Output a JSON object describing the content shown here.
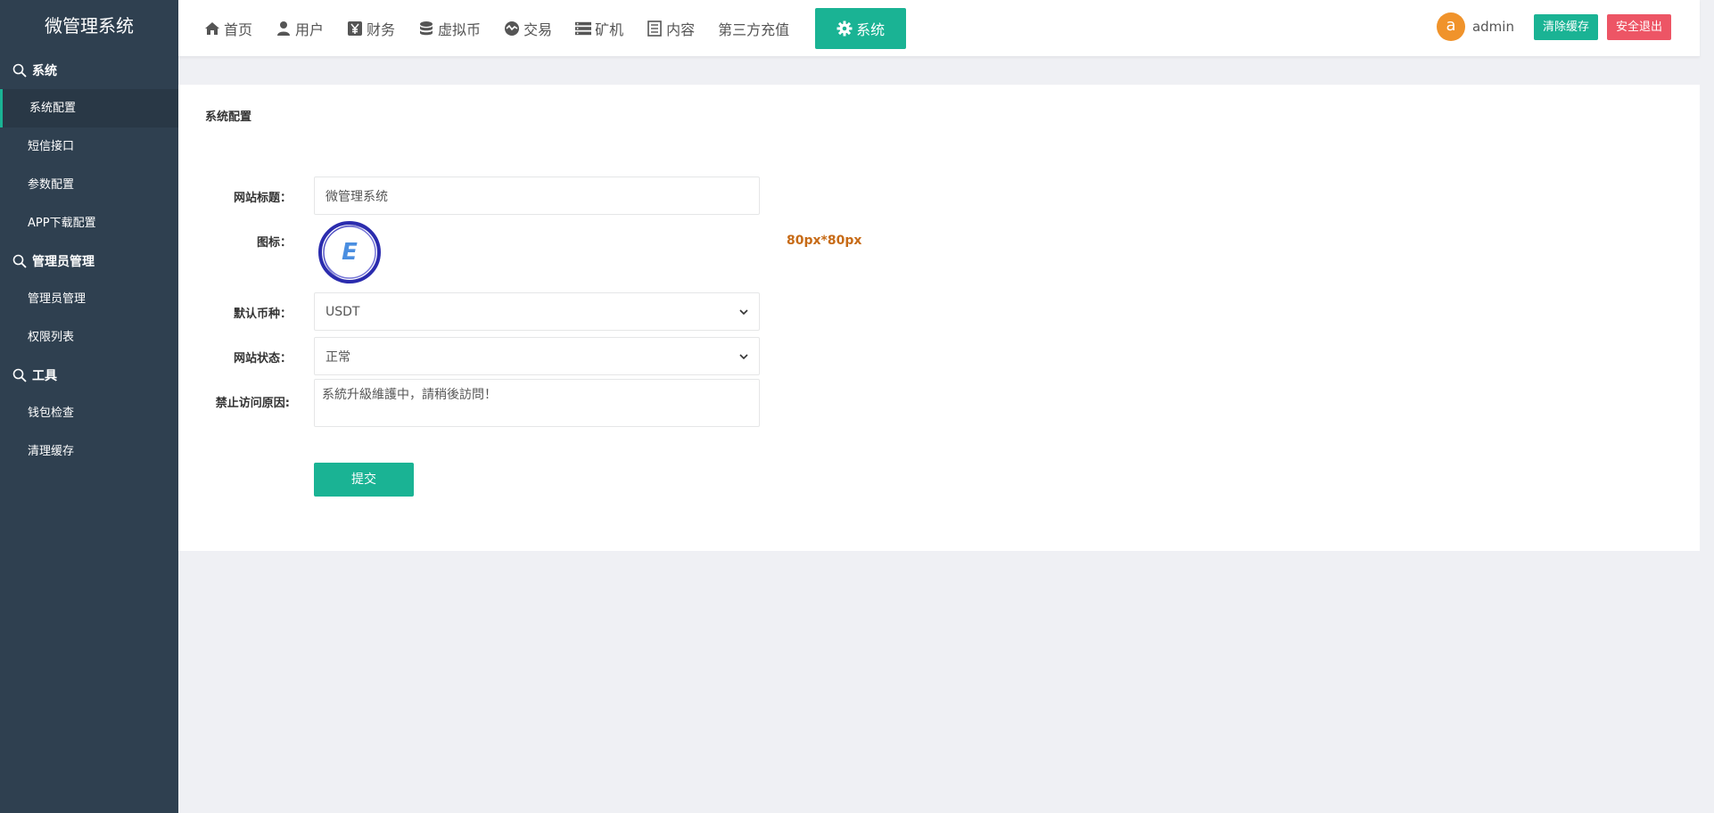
{
  "sidebar": {
    "brand": "微管理系统",
    "groups": [
      {
        "label": "系统",
        "items": [
          {
            "label": "系统配置"
          },
          {
            "label": "短信接口"
          },
          {
            "label": "参数配置"
          },
          {
            "label": "APP下载配置"
          }
        ]
      },
      {
        "label": "管理员管理",
        "items": [
          {
            "label": "管理员管理"
          },
          {
            "label": "权限列表"
          }
        ]
      },
      {
        "label": "工具",
        "items": [
          {
            "label": "钱包检查"
          },
          {
            "label": "清理缓存"
          }
        ]
      }
    ]
  },
  "nav": {
    "items": [
      {
        "label": "首页",
        "icon": "home-icon"
      },
      {
        "label": "用户",
        "icon": "user-icon"
      },
      {
        "label": "财务",
        "icon": "yen-icon"
      },
      {
        "label": "虚拟币",
        "icon": "database-icon"
      },
      {
        "label": "交易",
        "icon": "exchange-icon"
      },
      {
        "label": "矿机",
        "icon": "server-icon"
      },
      {
        "label": "内容",
        "icon": "list-icon"
      },
      {
        "label": "第三方充值"
      },
      {
        "label": "系统",
        "icon": "gear-icon"
      }
    ]
  },
  "user": {
    "avatar_letter": "a",
    "name": "admin",
    "clear_cache": "清除缓存",
    "logout": "安全退出"
  },
  "panel": {
    "title": "系统配置"
  },
  "form": {
    "site_title_label": "网站标题：",
    "site_title_value": "微管理系统",
    "icon_label": "图标：",
    "icon_hint": "80px*80px",
    "icon_letter": "E",
    "currency_label": "默认币种：",
    "currency_value": "USDT",
    "status_label": "网站状态：",
    "status_value": "正常",
    "reason_label": "禁止访问原因:",
    "reason_value": "系統升級維護中，請稍後訪問！",
    "submit": "提交"
  },
  "colors": {
    "sidebar_bg": "#2f4050",
    "accent": "#1ab394",
    "danger": "#ed5565",
    "avatar": "#f0932b",
    "hint": "#c76b17",
    "logo_ring": "#2b2cae"
  }
}
